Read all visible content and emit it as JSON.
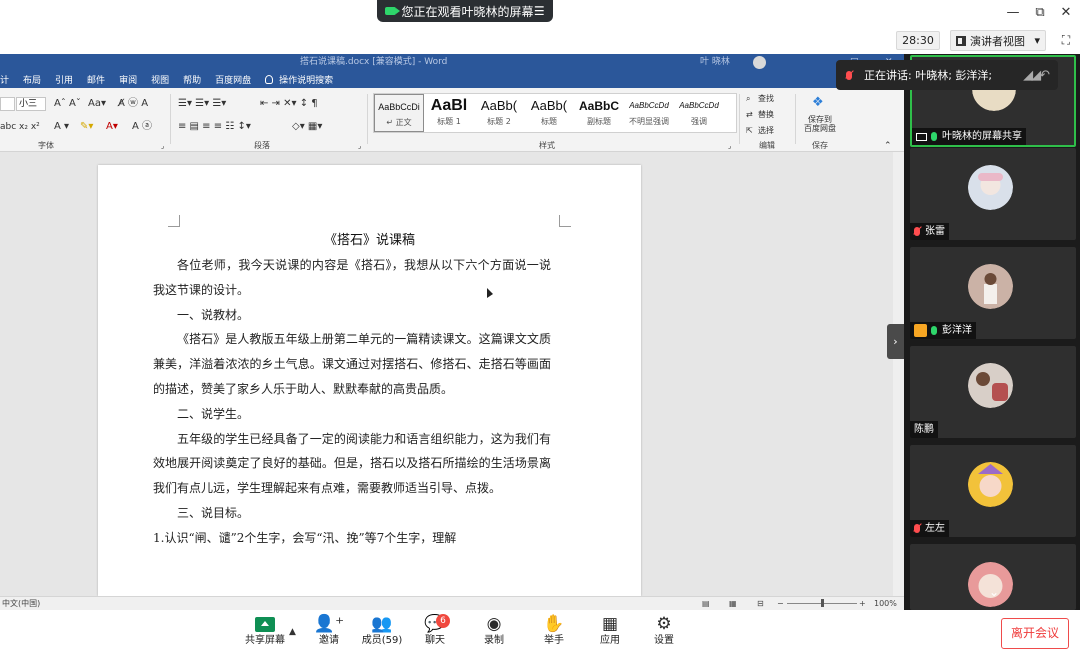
{
  "title_bar": {
    "watching_text": "您正在观看叶晓林的屏幕",
    "minimize": "—",
    "restore": "⧉",
    "close": "✕"
  },
  "meeting_bar": {
    "timer": "28:30",
    "view_mode": "演讲者视图",
    "view_caret": "▾",
    "fullscreen": "⛶"
  },
  "speaking": {
    "text": "正在讲话: 叶晓林; 彭洋洋;",
    "fade": "◢◢↶"
  },
  "word": {
    "doc_title": "搭石说课稿.docx [兼容模式] - Word",
    "author": "叶 晓林",
    "tabs": [
      "计",
      "布局",
      "引用",
      "邮件",
      "审阅",
      "视图",
      "帮助",
      "百度网盘"
    ],
    "tell_me": "操作说明搜索",
    "ribbon": {
      "font_name": "",
      "font_size": "小三",
      "groups": {
        "font": "字体",
        "paragraph": "段落",
        "styles": "样式",
        "editing": "编辑",
        "save": "保存"
      },
      "styles": [
        {
          "sample": "AaBbCcDi",
          "name": "↵ 正文"
        },
        {
          "sample": "AaBl",
          "name": "标题 1"
        },
        {
          "sample": "AaBb(",
          "name": "标题 2"
        },
        {
          "sample": "AaBb(",
          "name": "标题"
        },
        {
          "sample": "AaBbC",
          "name": "副标题"
        },
        {
          "sample": "AaBbCcDd",
          "name": "不明显强调"
        },
        {
          "sample": "AaBbCcDd",
          "name": "强调"
        }
      ],
      "find": "查找",
      "replace": "替换",
      "select": "选择",
      "save_to_baidu": "保存到\n百度网盘"
    },
    "document": {
      "title": "《搭石》说课稿",
      "paragraphs": [
        {
          "text": "各位老师，我今天说课的内容是《搭石》，我想从以下六个方面说一说我这节课的设计。",
          "indent": true
        },
        {
          "text": "一、说教材。",
          "indent": true
        },
        {
          "text": "《搭石》是人教版五年级上册第二单元的一篇精读课文。这篇课文文质兼美，洋溢着浓浓的乡土气息。课文通过对摆搭石、修搭石、走搭石等画面的描述，赞美了家乡人乐于助人、默默奉献的高贵品质。",
          "indent": true
        },
        {
          "text": "二、说学生。",
          "indent": true
        },
        {
          "text": "五年级的学生已经具备了一定的阅读能力和语言组织能力，这为我们有效地展开阅读奠定了良好的基础。但是，搭石以及搭石所描绘的生活场景离我们有点儿远，学生理解起来有点难，需要教师适当引导、点拨。",
          "indent": true
        },
        {
          "text": "三、说目标。",
          "indent": true
        },
        {
          "text": "1.认识“闸、谴”2个生字，会写“汛、挽”等7个生字，理解",
          "indent": false
        }
      ]
    },
    "status": {
      "language": "中文(中国)",
      "zoom": "100%"
    }
  },
  "participants": [
    {
      "name": "叶晓林的屏幕共享",
      "mic": "on",
      "share": true,
      "active": true,
      "avatar_color": "#e8dcc4"
    },
    {
      "name": "张雷",
      "mic": "off",
      "share": false,
      "active": false,
      "avatar_color": "#d9e0ea"
    },
    {
      "name": "彭洋洋",
      "mic": "on",
      "share": false,
      "host": true,
      "active": false,
      "avatar_color": "#cbb2a6"
    },
    {
      "name": "陈鹏",
      "mic": "none",
      "share": false,
      "active": false,
      "avatar_color": "#b45050"
    },
    {
      "name": "左左",
      "mic": "off",
      "share": false,
      "active": false,
      "avatar_color": "#f2c23a"
    },
    {
      "name": "",
      "mic": "none",
      "share": false,
      "active": false,
      "avatar_color": "#e89a9a"
    }
  ],
  "toolbar": {
    "share": "共享屏幕",
    "invite": "邀请",
    "members": "成员(59)",
    "chat": "聊天",
    "chat_badge": "6",
    "record": "录制",
    "raise_hand": "举手",
    "apps": "应用",
    "settings": "设置",
    "leave": "离开会议"
  }
}
